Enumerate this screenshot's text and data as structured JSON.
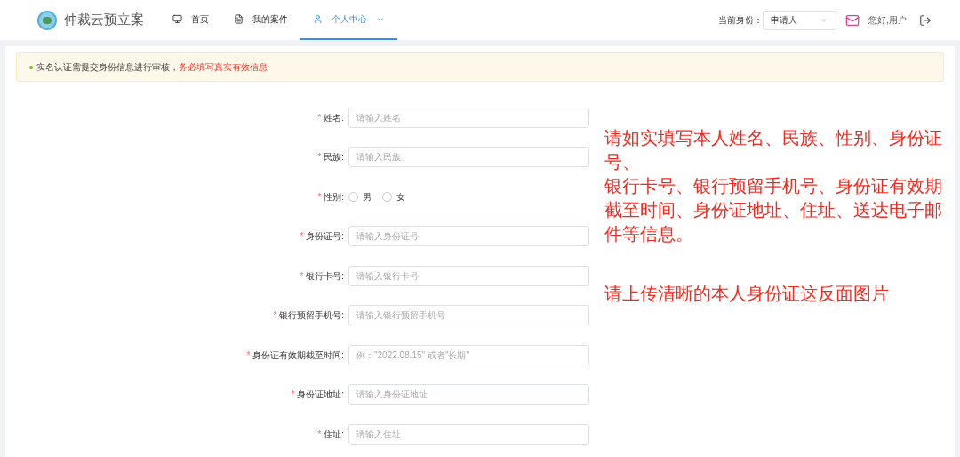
{
  "header": {
    "title": "仲裁云预立案",
    "nav": [
      {
        "label": "首页",
        "kind": "home",
        "selected": false
      },
      {
        "label": "我的案件",
        "kind": "cases",
        "selected": false
      },
      {
        "label": "个人中心",
        "kind": "user",
        "selected": true
      }
    ],
    "identity_label": "当前身份：",
    "identity_value": "申请人",
    "greeting": "您好,用户"
  },
  "notice": {
    "text": "实名认证需提交身份信息进行审核，",
    "emphasis": "务必填写真实有效信息"
  },
  "form": [
    {
      "kind": "input",
      "required_mark": "*",
      "label": "姓名:",
      "placeholder": "请输入姓名"
    },
    {
      "kind": "input",
      "required_mark": "*",
      "label": "民族:",
      "placeholder": "请输入民族"
    },
    {
      "kind": "radio",
      "required_mark": "*",
      "label": "性别:",
      "options": [
        {
          "label": "男",
          "selected": false
        },
        {
          "label": "女",
          "selected": false
        }
      ]
    },
    {
      "kind": "input",
      "required_mark": "*",
      "label": "身份证号:",
      "placeholder": "请输入身份证号"
    },
    {
      "kind": "input",
      "required_mark": "*",
      "label": "银行卡号:",
      "placeholder": "请输入银行卡号"
    },
    {
      "kind": "input",
      "required_mark": "*",
      "label": "银行预留手机号:",
      "placeholder": "请输入银行预留手机号"
    },
    {
      "kind": "input",
      "required_mark": "*",
      "label": "身份证有效期截至时间:",
      "placeholder": "例：\"2022.08.15\" 或者\"长期\""
    },
    {
      "kind": "input",
      "required_mark": "*",
      "label": "身份证地址:",
      "placeholder": "请输入身份证地址"
    },
    {
      "kind": "input",
      "required_mark": "*",
      "label": "住址:",
      "placeholder": "请输入住址"
    }
  ],
  "annotations": [
    {
      "lines": [
        "请如实填写本人姓名、民族、性别、身份证号、",
        "银行卡号、银行预留手机号、身份证有效期截至时间、身份证地址、住址、送达电子邮件等信息。"
      ]
    },
    {
      "lines": [
        "请上传清晰的本人身份证这反面图片"
      ]
    }
  ]
}
